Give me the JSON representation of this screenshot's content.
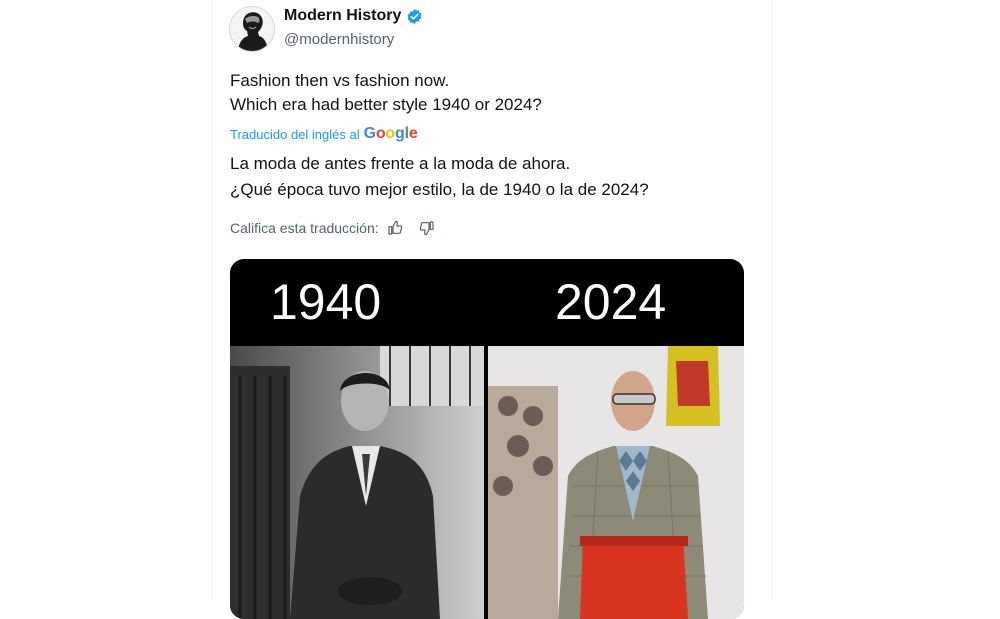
{
  "author": {
    "display_name": "Modern History",
    "handle": "@modernhistory"
  },
  "tweet": {
    "line1": "Fashion then vs fashion now.",
    "line2": "Which era had better style  1940 or 2024?"
  },
  "translation": {
    "label": "Traducido del inglés al",
    "provider": "Google",
    "line1": "La moda de antes frente a la moda de ahora.",
    "line2": "¿Qué época tuvo mejor estilo, la de 1940 o la de 2024?",
    "rate_label": "Califica esta traducción:"
  },
  "media": {
    "left_label": "1940",
    "right_label": "2024"
  },
  "colors": {
    "link": "#1d9bf0",
    "secondary_text": "#536471",
    "verified": "#1d9bf0"
  }
}
